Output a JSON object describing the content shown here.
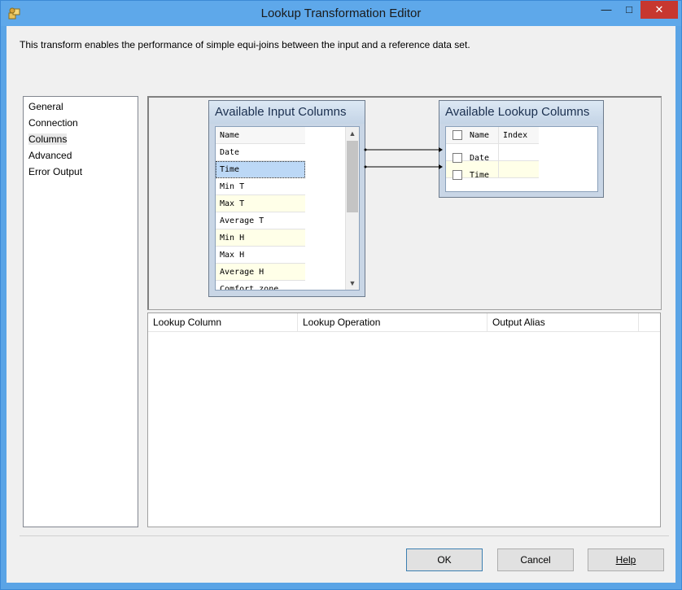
{
  "window": {
    "title": "Lookup Transformation Editor",
    "minimize_glyph": "—",
    "maximize_glyph": "□",
    "close_glyph": "✕"
  },
  "description": "This transform enables the performance of simple equi-joins between the input and a reference data set.",
  "nav": {
    "items": [
      {
        "label": "General"
      },
      {
        "label": "Connection"
      },
      {
        "label": "Columns",
        "selected": true
      },
      {
        "label": "Advanced"
      },
      {
        "label": "Error Output"
      }
    ]
  },
  "input_columns": {
    "title": "Available Input Columns",
    "header": "Name",
    "rows": [
      "Date",
      "Time",
      "Min T",
      "Max T",
      "Average T",
      "Min H",
      "Max H",
      "Average H",
      "Comfort zone"
    ],
    "selected_row": "Time"
  },
  "lookup_columns": {
    "title": "Available Lookup Columns",
    "headers": [
      "Name",
      "Index"
    ],
    "rows": [
      "Date",
      "Time"
    ]
  },
  "mappings": [
    {
      "from": "Date",
      "to": "Date"
    },
    {
      "from": "Time",
      "to": "Time"
    }
  ],
  "lookup_grid": {
    "columns": [
      "Lookup Column",
      "Lookup Operation",
      "Output Alias"
    ]
  },
  "buttons": {
    "ok": "OK",
    "cancel": "Cancel",
    "help": "Help"
  },
  "colors": {
    "titlebar": "#5ea8ea",
    "close": "#c7372f",
    "row_alt": "#ffffe8",
    "row_selected": "#bcd8f6"
  },
  "icons": {
    "app": "ssis-package-icon",
    "scroll_up": "chevron-up-icon",
    "scroll_down": "chevron-down-icon"
  }
}
